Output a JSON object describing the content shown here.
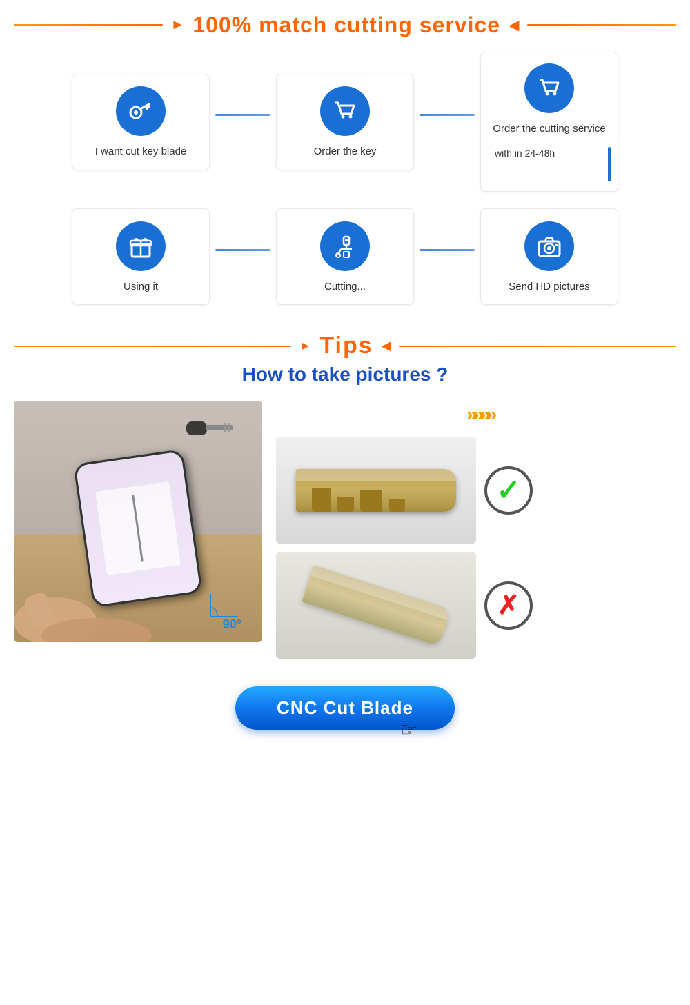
{
  "header": {
    "title": "100% match cutting service",
    "arrow_left": "◄",
    "arrow_right": "►"
  },
  "flow_row1": {
    "card1": {
      "label": "I want cut key blade",
      "icon": "keys"
    },
    "card2": {
      "label": "Order the key",
      "icon": "cart"
    },
    "card3": {
      "label": "Order the cutting service",
      "icon": "cart",
      "sub_label": "with in 24-48h"
    }
  },
  "flow_row2": {
    "card1": {
      "label": "Using it",
      "icon": "gift"
    },
    "card2": {
      "label": "Cutting...",
      "icon": "robot"
    },
    "card3": {
      "label": "Send HD pictures",
      "icon": "camera"
    }
  },
  "tips": {
    "title": "Tips",
    "subtitle": "How to take pictures ?"
  },
  "cnc_button": {
    "label": "CNC Cut Blade"
  }
}
